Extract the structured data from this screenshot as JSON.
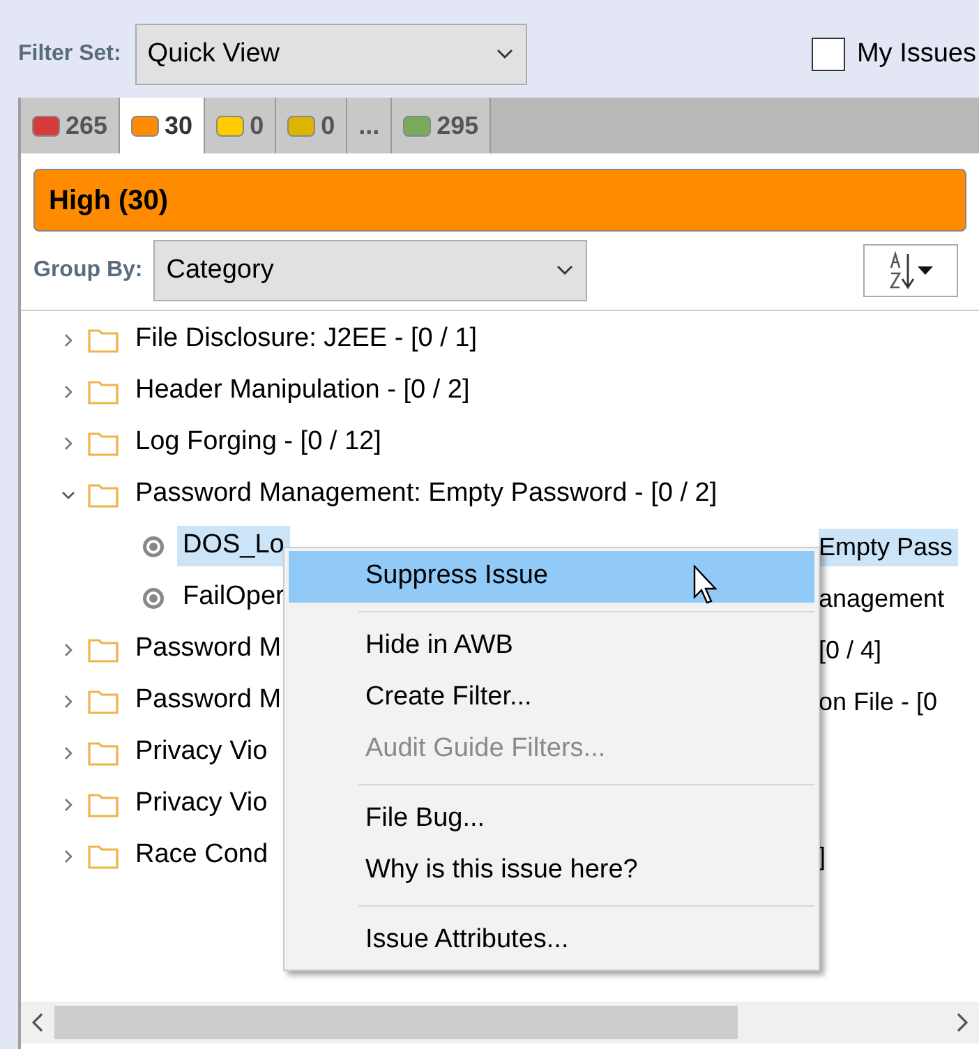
{
  "filter_set": {
    "label": "Filter Set:",
    "value": "Quick View"
  },
  "my_issues": {
    "label": "My Issues",
    "checked": false
  },
  "tabs": [
    {
      "label": "265",
      "color": "#d63b3b",
      "selected": false
    },
    {
      "label": "30",
      "color": "#ff8c00",
      "selected": true
    },
    {
      "label": "0",
      "color": "#ffcc00",
      "selected": false
    },
    {
      "label": "0",
      "color": "#ddb400",
      "selected": false
    },
    {
      "label": "...",
      "selected": false
    },
    {
      "label": "295",
      "color": "#7aab5a",
      "selected": false
    }
  ],
  "banner": {
    "text": "High (30)",
    "color": "#ff8c00"
  },
  "group_by": {
    "label": "Group By:",
    "value": "Category"
  },
  "tree": [
    {
      "kind": "folder",
      "left": "File Disclosure: J2EE - [0 / 1]",
      "expanded": false
    },
    {
      "kind": "folder",
      "left": "Header Manipulation - [0 / 2]",
      "expanded": false
    },
    {
      "kind": "folder",
      "left": "Log Forging - [0 / 12]",
      "expanded": false
    },
    {
      "kind": "folder",
      "left": "Password Management: Empty Password - [0 / 2]",
      "expanded": true,
      "children": [
        {
          "kind": "issue",
          "left": "DOS_Lo",
          "right": "Empty Pass",
          "selected": true
        },
        {
          "kind": "issue",
          "left": "FailOper",
          "right": "anagement",
          "selected": false
        }
      ]
    },
    {
      "kind": "folder",
      "left": "Password M",
      "right": "[0 / 4]",
      "expanded": false
    },
    {
      "kind": "folder",
      "left": "Password M",
      "right": "on File - [0",
      "expanded": false
    },
    {
      "kind": "folder",
      "left": "Privacy Vio",
      "expanded": false
    },
    {
      "kind": "folder",
      "left": "Privacy Vio",
      "expanded": false
    },
    {
      "kind": "folder",
      "left": "Race Cond",
      "right": "]",
      "expanded": false
    }
  ],
  "context_menu": [
    {
      "kind": "item",
      "label": "Suppress Issue",
      "selected": true,
      "disabled": false
    },
    {
      "kind": "separator"
    },
    {
      "kind": "item",
      "label": "Hide in AWB",
      "selected": false,
      "disabled": false
    },
    {
      "kind": "item",
      "label": "Create Filter...",
      "selected": false,
      "disabled": false
    },
    {
      "kind": "item",
      "label": "Audit Guide Filters...",
      "selected": false,
      "disabled": true
    },
    {
      "kind": "separator"
    },
    {
      "kind": "item",
      "label": "File Bug...",
      "selected": false,
      "disabled": false
    },
    {
      "kind": "item",
      "label": "Why is this issue here?",
      "selected": false,
      "disabled": false
    },
    {
      "kind": "separator"
    },
    {
      "kind": "item",
      "label": "Issue Attributes...",
      "selected": false,
      "disabled": false
    }
  ]
}
